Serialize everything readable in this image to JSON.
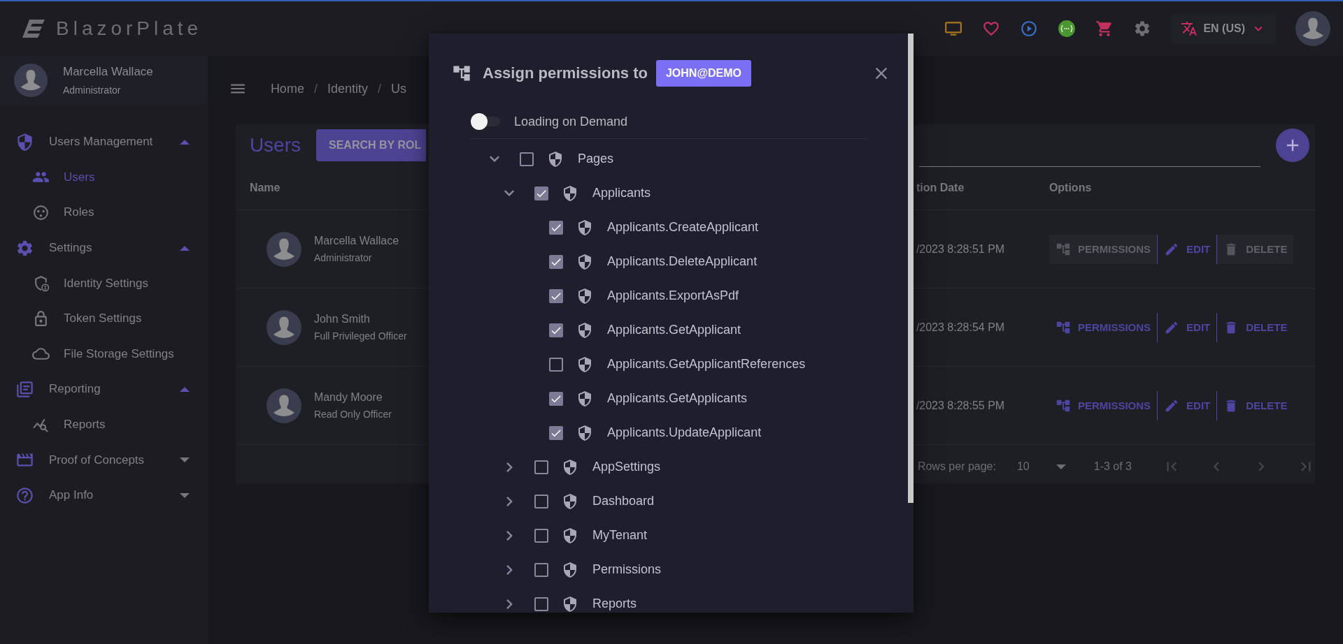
{
  "topbar": {
    "logo_text": "BlazorPlate",
    "language": "EN (US)"
  },
  "sidebar": {
    "user": {
      "name": "Marcella Wallace",
      "role": "Administrator"
    },
    "groups": [
      {
        "label": "Users Management",
        "expanded": true,
        "items": [
          {
            "label": "Users",
            "selected": true
          },
          {
            "label": "Roles",
            "selected": false
          }
        ]
      },
      {
        "label": "Settings",
        "expanded": true,
        "items": [
          {
            "label": "Identity Settings",
            "selected": false
          },
          {
            "label": "Token Settings",
            "selected": false
          },
          {
            "label": "File Storage Settings",
            "selected": false
          }
        ]
      },
      {
        "label": "Reporting",
        "expanded": true,
        "items": [
          {
            "label": "Reports",
            "selected": false
          }
        ]
      },
      {
        "label": "Proof of Concepts",
        "expanded": false
      },
      {
        "label": "App Info",
        "expanded": false
      }
    ]
  },
  "breadcrumb": [
    {
      "kind": "link",
      "text": "Home"
    },
    {
      "kind": "separator",
      "text": "/"
    },
    {
      "kind": "link",
      "text": "Identity"
    },
    {
      "kind": "separator",
      "text": "/"
    },
    {
      "kind": "link",
      "text": "Us"
    }
  ],
  "users_card": {
    "title": "Users",
    "search_button": "SEARCH BY ROL",
    "columns": [
      "Name",
      "tion Date",
      "Options"
    ],
    "rows": [
      {
        "name": "Marcella Wallace",
        "role": "Administrator",
        "date": "/2023 8:28:51 PM",
        "actions": [
          {
            "kind": "permissions",
            "label": "PERMISSIONS",
            "disabled": true
          },
          {
            "kind": "edit",
            "label": "EDIT",
            "disabled": false
          },
          {
            "kind": "delete",
            "label": "DELETE",
            "disabled": true
          }
        ]
      },
      {
        "name": "John Smith",
        "role": "Full Privileged Officer",
        "date": "/2023 8:28:54 PM",
        "actions": [
          {
            "kind": "permissions",
            "label": "PERMISSIONS",
            "disabled": false
          },
          {
            "kind": "edit",
            "label": "EDIT",
            "disabled": false
          },
          {
            "kind": "delete",
            "label": "DELETE",
            "disabled": false
          }
        ]
      },
      {
        "name": "Mandy Moore",
        "role": "Read Only Officer",
        "date": "/2023 8:28:55 PM",
        "actions": [
          {
            "kind": "permissions",
            "label": "PERMISSIONS",
            "disabled": false
          },
          {
            "kind": "edit",
            "label": "EDIT",
            "disabled": false
          },
          {
            "kind": "delete",
            "label": "DELETE",
            "disabled": false
          }
        ]
      }
    ],
    "pagination": {
      "rows_per_page_label": "Rows per page:",
      "rows_per_page": "10",
      "range": "1-3 of 3"
    }
  },
  "dialog": {
    "title": "Assign permissions to",
    "badge": "JOHN@DEMO",
    "toggle": {
      "label": "Loading on Demand",
      "on": false
    },
    "tree": [
      {
        "label": "Pages",
        "checked": false,
        "expanded": true,
        "children": [
          {
            "label": "Applicants",
            "checked": true,
            "expanded": true,
            "children": [
              {
                "label": "Applicants.CreateApplicant",
                "checked": true
              },
              {
                "label": "Applicants.DeleteApplicant",
                "checked": true
              },
              {
                "label": "Applicants.ExportAsPdf",
                "checked": true
              },
              {
                "label": "Applicants.GetApplicant",
                "checked": true
              },
              {
                "label": "Applicants.GetApplicantReferences",
                "checked": false
              },
              {
                "label": "Applicants.GetApplicants",
                "checked": true
              },
              {
                "label": "Applicants.UpdateApplicant",
                "checked": true
              }
            ]
          },
          {
            "label": "AppSettings",
            "checked": false,
            "expanded": false
          },
          {
            "label": "Dashboard",
            "checked": false,
            "expanded": false
          },
          {
            "label": "MyTenant",
            "checked": false,
            "expanded": false
          },
          {
            "label": "Permissions",
            "checked": false,
            "expanded": false
          },
          {
            "label": "Reports",
            "checked": false,
            "expanded": false
          }
        ]
      }
    ]
  }
}
